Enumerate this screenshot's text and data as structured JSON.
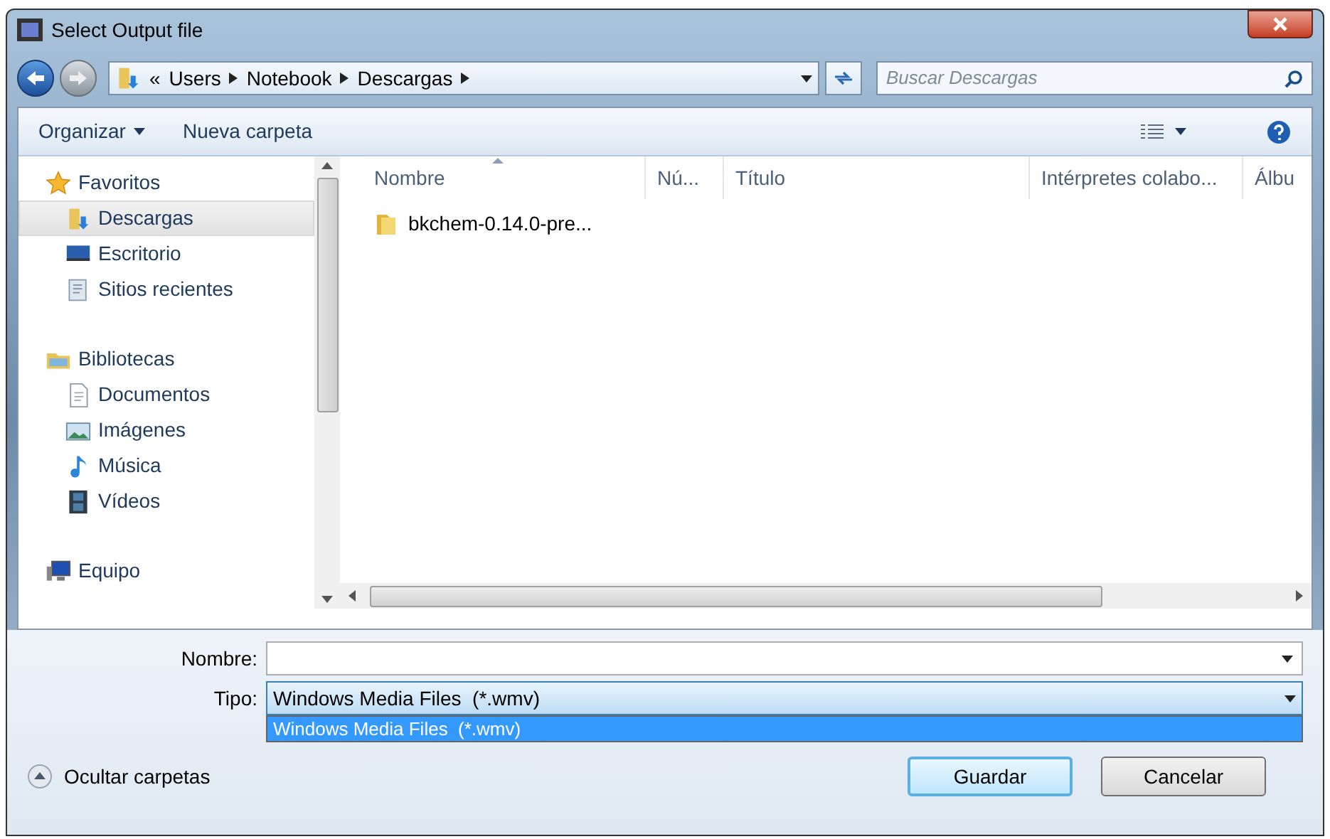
{
  "window": {
    "title": "Select Output file"
  },
  "breadcrumb": {
    "overflow": "«",
    "items": [
      "Users",
      "Notebook",
      "Descargas"
    ]
  },
  "search": {
    "placeholder": "Buscar Descargas"
  },
  "toolbar": {
    "organize": "Organizar",
    "new_folder": "Nueva carpeta"
  },
  "sidebar": [
    {
      "label": "Favoritos",
      "kind": "star",
      "selected": false,
      "children": [
        {
          "label": "Descargas",
          "kind": "download",
          "selected": true
        },
        {
          "label": "Escritorio",
          "kind": "desktop",
          "selected": false
        },
        {
          "label": "Sitios recientes",
          "kind": "recent",
          "selected": false
        }
      ]
    },
    {
      "label": "Bibliotecas",
      "kind": "library",
      "selected": false,
      "children": [
        {
          "label": "Documentos",
          "kind": "document",
          "selected": false
        },
        {
          "label": "Imágenes",
          "kind": "image",
          "selected": false
        },
        {
          "label": "Música",
          "kind": "music",
          "selected": false
        },
        {
          "label": "Vídeos",
          "kind": "video",
          "selected": false
        }
      ]
    },
    {
      "label": "Equipo",
      "kind": "computer",
      "selected": false
    }
  ],
  "columns": [
    {
      "label": "Nombre",
      "sorted": true
    },
    {
      "label": "Nú...",
      "sorted": false
    },
    {
      "label": "Título",
      "sorted": false
    },
    {
      "label": "Intérpretes colabo...",
      "sorted": false
    },
    {
      "label": "Álbu",
      "sorted": false
    }
  ],
  "files": [
    {
      "name": "bkchem-0.14.0-pre..."
    }
  ],
  "form": {
    "name_label": "Nombre:",
    "type_label": "Tipo:",
    "type_value": "Windows Media Files  (*.wmv)",
    "type_options": [
      {
        "label": "Windows Media Files  (*.wmv)",
        "selected": true
      }
    ]
  },
  "hide_folders": "Ocultar carpetas",
  "buttons": [
    {
      "label": "Guardar",
      "default": true
    },
    {
      "label": "Cancelar",
      "default": false
    }
  ]
}
